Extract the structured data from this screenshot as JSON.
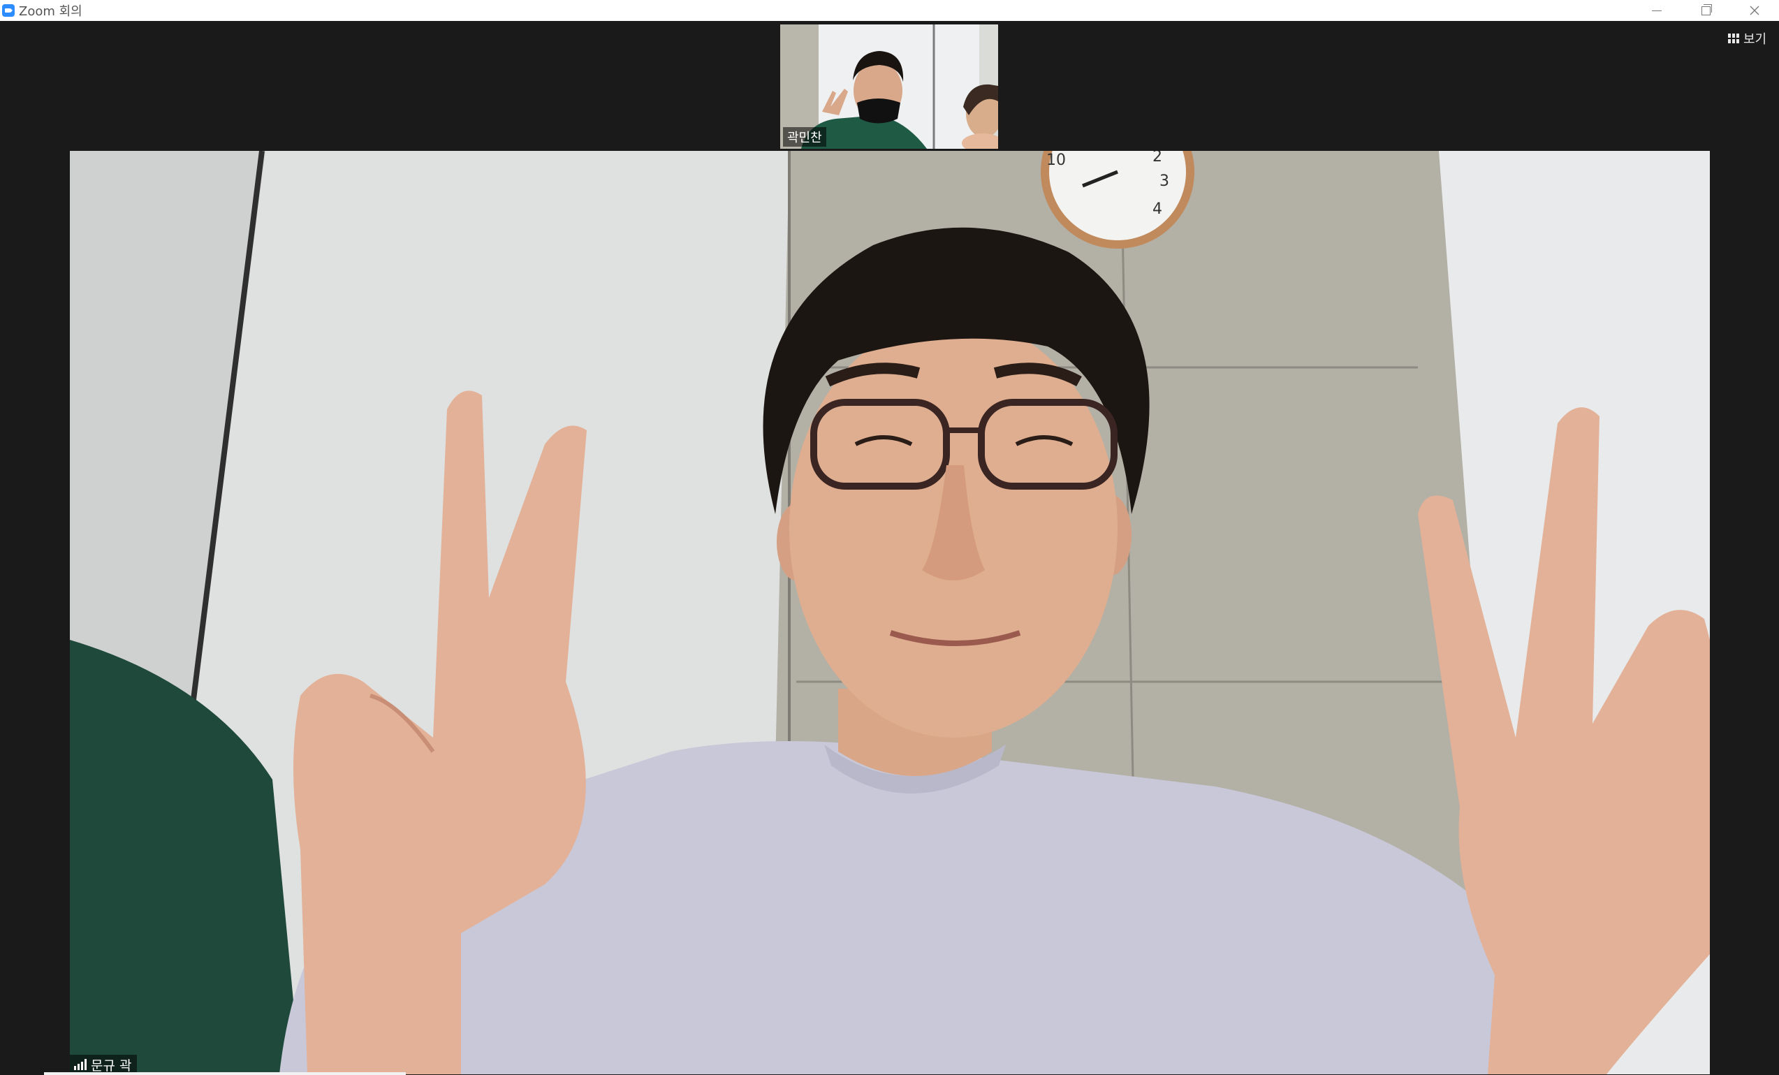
{
  "window": {
    "title": "Zoom 회의",
    "controls": [
      "minimize",
      "restore",
      "close"
    ]
  },
  "toolbar": {
    "view_label": "보기",
    "view_icon": "grid-icon"
  },
  "thumbnail": {
    "participant_name": "곽민찬"
  },
  "active_speaker": {
    "participant_name": "문규 곽",
    "signal_icon": "signal-strength-icon"
  }
}
